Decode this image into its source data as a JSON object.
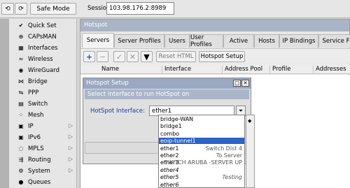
{
  "toolbar": {
    "undo_glyph": "⟲",
    "redo_glyph": "⟳",
    "safe_mode_label": "Safe Mode",
    "session_label": "Session:",
    "session_value": "103.98.176.2:8989"
  },
  "sidebar": {
    "items": [
      {
        "label": "Quick Set",
        "icon": "✔",
        "arrow": ""
      },
      {
        "label": "CAPsMAN",
        "icon": "⊕",
        "arrow": ""
      },
      {
        "label": "Interfaces",
        "icon": "▦",
        "arrow": ""
      },
      {
        "label": "Wireless",
        "icon": "≈",
        "arrow": ""
      },
      {
        "label": "WireGuard",
        "icon": "◉",
        "arrow": ""
      },
      {
        "label": "Bridge",
        "icon": "⋈",
        "arrow": ""
      },
      {
        "label": "PPP",
        "icon": "⇆",
        "arrow": ""
      },
      {
        "label": "Switch",
        "icon": "▤",
        "arrow": ""
      },
      {
        "label": "Mesh",
        "icon": "⁘",
        "arrow": ""
      },
      {
        "label": "IP",
        "icon": "▣",
        "arrow": "▷"
      },
      {
        "label": "IPv6",
        "icon": "▣",
        "arrow": "▷"
      },
      {
        "label": "MPLS",
        "icon": "◌",
        "arrow": "▷"
      },
      {
        "label": "Routing",
        "icon": "⇶",
        "arrow": "▷"
      },
      {
        "label": "System",
        "icon": "⚙",
        "arrow": "▷"
      },
      {
        "label": "Queues",
        "icon": "●",
        "arrow": ""
      }
    ]
  },
  "hotspot": {
    "title": "Hotspot",
    "tabs": [
      "Servers",
      "Server Profiles",
      "Users",
      "User Profiles",
      "Active",
      "Hosts",
      "IP Bindings",
      "Service F"
    ],
    "reset_html_label": "Reset HTML",
    "hotspot_setup_label": "Hotspot Setup",
    "columns": [
      "Name",
      "Interface",
      "Address Pool",
      "Profile",
      "Addresses ..."
    ]
  },
  "dialog": {
    "title": "Hotspot Setup",
    "subtitle": "Select interface to run HotSpot on",
    "field_label": "HotSpot Interface:",
    "field_value": "ether1",
    "drop_glyph": "⏷",
    "close_glyph": "✕",
    "max_glyph": "□"
  },
  "dropdown": {
    "options": [
      {
        "name": "bridge-WAN",
        "comment": "",
        "selected": false,
        "italic": false
      },
      {
        "name": "bridge1",
        "comment": "",
        "selected": false,
        "italic": false
      },
      {
        "name": "combo",
        "comment": "",
        "selected": false,
        "italic": false
      },
      {
        "name": "eoip-tunnel1",
        "comment": "",
        "selected": true,
        "italic": false
      },
      {
        "name": "ether1",
        "comment": "Switch Dist 4",
        "selected": false,
        "italic": false
      },
      {
        "name": "ether2",
        "comment": "To Server",
        "selected": false,
        "italic": false
      },
      {
        "name": "ether3",
        "comment": "SWITCH ARUBA -SERVER UP",
        "selected": false,
        "italic": false
      },
      {
        "name": "ether4",
        "comment": "",
        "selected": false,
        "italic": true
      },
      {
        "name": "ether5",
        "comment": "Testing",
        "selected": false,
        "italic": true
      },
      {
        "name": "ether6",
        "comment": "",
        "selected": false,
        "italic": true
      }
    ],
    "scroll_glyph": "◆"
  }
}
